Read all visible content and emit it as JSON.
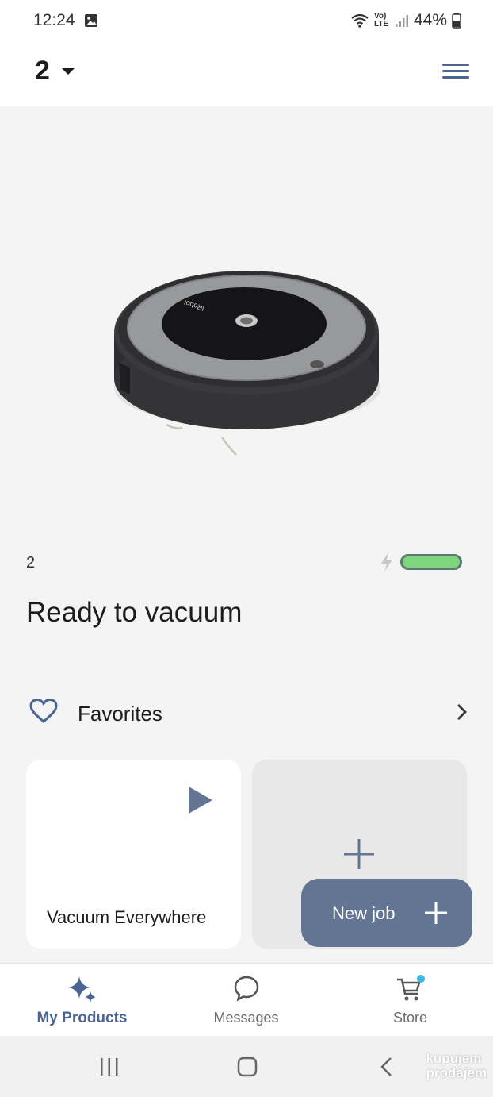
{
  "status_bar": {
    "time": "12:24",
    "battery": "44%",
    "network": "LTE"
  },
  "header": {
    "robot_name": "2"
  },
  "robot": {
    "name": "2",
    "battery_level": 1.0,
    "status": "Ready to vacuum"
  },
  "favorites": {
    "label": "Favorites"
  },
  "cards": {
    "job_label": "Vacuum Everywhere"
  },
  "new_job": {
    "label": "New job"
  },
  "bottom_nav": {
    "items": [
      {
        "label": "My Products",
        "icon": "sparkle-icon"
      },
      {
        "label": "Messages",
        "icon": "chat-bubble-icon"
      },
      {
        "label": "Store",
        "icon": "cart-icon"
      }
    ]
  },
  "watermark": {
    "line1": "kupujem",
    "line2": "prodajem"
  },
  "colors": {
    "accent": "#627693",
    "active_nav": "#4a6593",
    "battery": "#7fd57e"
  }
}
